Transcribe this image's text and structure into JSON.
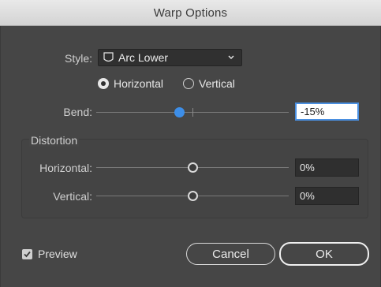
{
  "window": {
    "title": "Warp Options"
  },
  "style": {
    "label": "Style:",
    "selected": "Arc Lower",
    "icon": "arc-lower-shape-icon"
  },
  "orientation": {
    "options": [
      {
        "label": "Horizontal",
        "checked": true
      },
      {
        "label": "Vertical",
        "checked": false
      }
    ]
  },
  "bend": {
    "label": "Bend:",
    "value": "-15%",
    "slider_fraction": 0.425
  },
  "distortion": {
    "title": "Distortion",
    "horizontal": {
      "label": "Horizontal:",
      "value": "0%",
      "slider_fraction": 0.5
    },
    "vertical": {
      "label": "Vertical:",
      "value": "0%",
      "slider_fraction": 0.5
    }
  },
  "preview": {
    "label": "Preview",
    "checked": true
  },
  "buttons": {
    "cancel": "Cancel",
    "ok": "OK"
  },
  "colors": {
    "accent": "#3d8ee8",
    "background": "#464646",
    "field": "#2f2f2f"
  }
}
